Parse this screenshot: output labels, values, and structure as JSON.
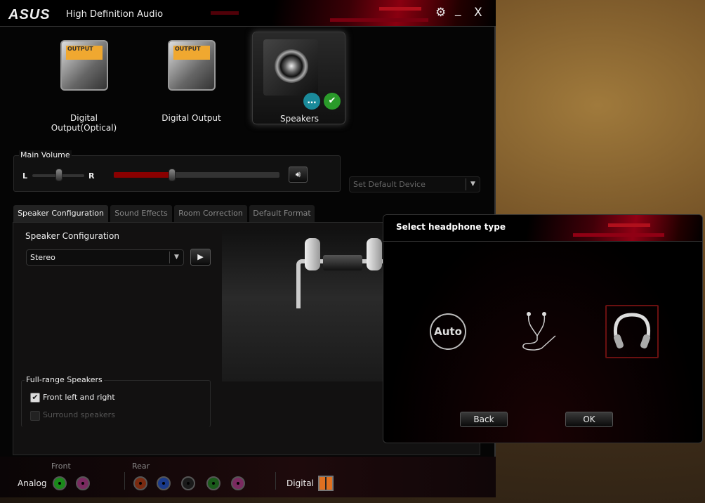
{
  "window": {
    "logo": "ASUS",
    "title": "High Definition Audio",
    "settings_icon": "gear-icon",
    "minimize_label": "_",
    "close_label": "X"
  },
  "devices": [
    {
      "label": "Digital Output(Optical)",
      "screen": "OUTPUT",
      "selected": false
    },
    {
      "label": "Digital Output",
      "screen": "OUTPUT",
      "selected": false
    },
    {
      "label": "Speakers",
      "selected": true,
      "badges": [
        "chat-icon",
        "check-icon"
      ]
    }
  ],
  "volume": {
    "label": "Main Volume",
    "left": "L",
    "right": "R",
    "balance": 0.5,
    "level": 0.35,
    "mute_icon": "speaker-icon"
  },
  "default_device": {
    "label": "Set Default Device"
  },
  "tabs": [
    {
      "label": "Speaker Configuration",
      "active": true
    },
    {
      "label": "Sound Effects",
      "active": false
    },
    {
      "label": "Room Correction",
      "active": false
    },
    {
      "label": "Default Format",
      "active": false
    }
  ],
  "speaker_config": {
    "label": "Speaker Configuration",
    "value": "Stereo",
    "play_icon": "play-icon"
  },
  "full_range": {
    "label": "Full-range Speakers",
    "options": [
      {
        "label": "Front left and right",
        "checked": true,
        "enabled": true
      },
      {
        "label": "Surround speakers",
        "checked": false,
        "enabled": false
      }
    ]
  },
  "jacks": {
    "front_label": "Front",
    "rear_label": "Rear",
    "analog_label": "Analog",
    "digital_label": "Digital",
    "front_colors": [
      "#1a8a1a",
      "#7a2a60"
    ],
    "rear_colors": [
      "#7a2a10",
      "#1a3a8a",
      "#1a1a1a",
      "#1a5a1a",
      "#7a2a60"
    ]
  },
  "dialog": {
    "title": "Select headphone type",
    "options": [
      {
        "label": "Auto",
        "selected": false
      },
      {
        "icon": "earbuds-icon",
        "selected": false
      },
      {
        "icon": "headphones-icon",
        "selected": true
      }
    ],
    "back_label": "Back",
    "ok_label": "OK"
  },
  "colors": {
    "accent": "#b0101c",
    "volume_fill": "#8a0000"
  }
}
